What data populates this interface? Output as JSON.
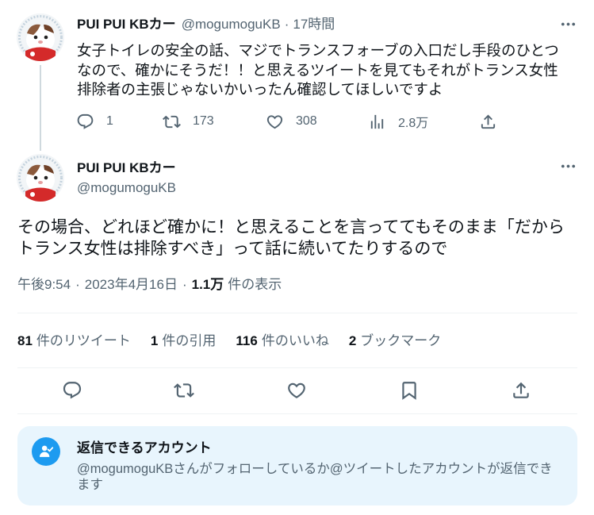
{
  "parent_tweet": {
    "display_name": "PUI PUI KBカー",
    "handle": "@mogumoguKB",
    "separator": "·",
    "time": "17時間",
    "text": "女子トイレの安全の話、マジでトランスフォーブの入口だし手段のひとつなので、確かにそうだ！！と思えるツイートを見てもそれがトランス女性排除者の主張じゃないかいったん確認してほしいですよ",
    "stats": {
      "replies": "1",
      "retweets": "173",
      "likes": "308",
      "views": "2.8万"
    }
  },
  "main_tweet": {
    "display_name": "PUI PUI KBカー",
    "handle": "@mogumoguKB",
    "text": "その場合、どれほど確かに！と思えることを言っててもそのまま「だからトランス女性は排除すべき」って話に続いてたりするので",
    "meta": {
      "time": "午後9:54",
      "separator": "·",
      "date": "2023年4月16日",
      "views_count": "1.1万",
      "views_label": "件の表示"
    },
    "engagement": [
      {
        "count": "81",
        "label": "件のリツイート"
      },
      {
        "count": "1",
        "label": "件の引用"
      },
      {
        "count": "116",
        "label": "件のいいね"
      },
      {
        "count": "2",
        "label": "ブックマーク"
      }
    ]
  },
  "reply_restriction": {
    "title": "返信できるアカウント",
    "body": "@mogumoguKBさんがフォローしているか@ツイートしたアカウントが返信できます"
  },
  "icons": {
    "more": "more-icon",
    "reply": "reply-icon",
    "retweet": "retweet-icon",
    "like": "heart-icon",
    "views": "views-chart-icon",
    "bookmark": "bookmark-icon",
    "share": "share-icon",
    "reply_restriction": "person-check-icon"
  },
  "colors": {
    "text_primary": "#0f1419",
    "text_secondary": "#536471",
    "accent": "#1d9bf0",
    "divider": "#eff3f4",
    "thread_line": "#cfd9de",
    "notice_bg": "#e8f5fd"
  }
}
